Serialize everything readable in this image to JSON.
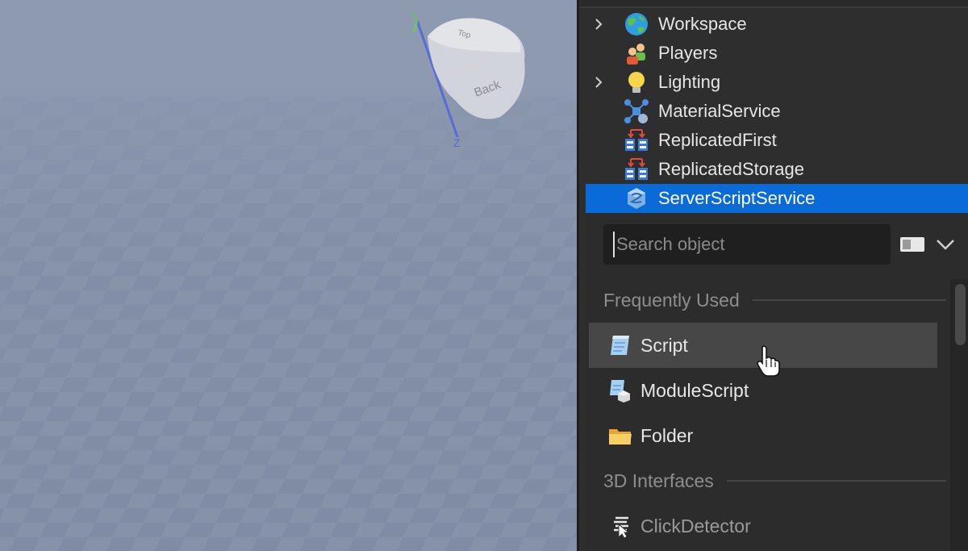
{
  "viewport": {
    "axis_y_label": "Y",
    "axis_z_label": "Z",
    "cube_top_label": "Top",
    "cube_side_label": "Back"
  },
  "explorer": {
    "items": [
      {
        "label": "Workspace",
        "icon": "globe-icon",
        "expandable": true
      },
      {
        "label": "Players",
        "icon": "players-icon",
        "expandable": false
      },
      {
        "label": "Lighting",
        "icon": "lightbulb-icon",
        "expandable": true
      },
      {
        "label": "MaterialService",
        "icon": "material-service-icon",
        "expandable": false
      },
      {
        "label": "ReplicatedFirst",
        "icon": "replicated-icon",
        "expandable": false
      },
      {
        "label": "ReplicatedStorage",
        "icon": "replicated-icon",
        "expandable": false
      },
      {
        "label": "ServerScriptService",
        "icon": "server-script-service-icon",
        "expandable": false,
        "selected": true
      }
    ]
  },
  "insert": {
    "search_placeholder": "Search object",
    "sections": [
      {
        "title": "Frequently Used"
      },
      {
        "title": "3D Interfaces"
      }
    ],
    "items": [
      {
        "label": "Script",
        "icon": "script-icon",
        "hovered": true
      },
      {
        "label": "ModuleScript",
        "icon": "module-script-icon"
      },
      {
        "label": "Folder",
        "icon": "folder-icon"
      },
      {
        "label": "ClickDetector",
        "icon": "click-detector-icon",
        "dim": true
      }
    ]
  },
  "colors": {
    "selection": "#0a6ad8",
    "panel_bg": "#2e2e2e",
    "viewport_sky": "#8e9ab0"
  }
}
